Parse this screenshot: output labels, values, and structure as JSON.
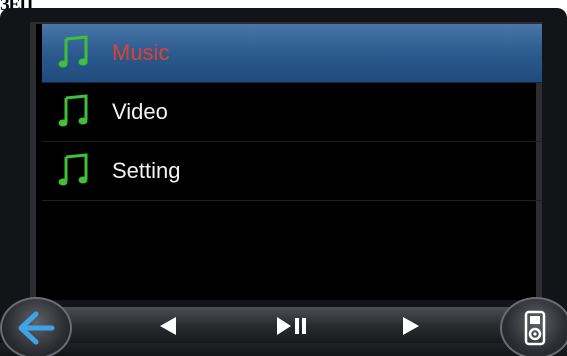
{
  "corner_text": "ЗЕЦ",
  "menu": {
    "items": [
      {
        "label": "Music",
        "selected": true,
        "icon": "music-note-icon"
      },
      {
        "label": "Video",
        "selected": false,
        "icon": "music-note-icon"
      },
      {
        "label": "Setting",
        "selected": false,
        "icon": "music-note-icon"
      }
    ]
  },
  "controls": {
    "back_icon": "back-arrow-icon",
    "prev_icon": "previous-icon",
    "play_pause_icon": "play-pause-icon",
    "next_icon": "next-icon",
    "device_icon": "media-player-icon"
  },
  "colors": {
    "selected_bg": "#2f5d91",
    "selected_text": "#e0412f",
    "icon_green": "#3fbf3a",
    "back_arrow": "#3fa4e6"
  }
}
